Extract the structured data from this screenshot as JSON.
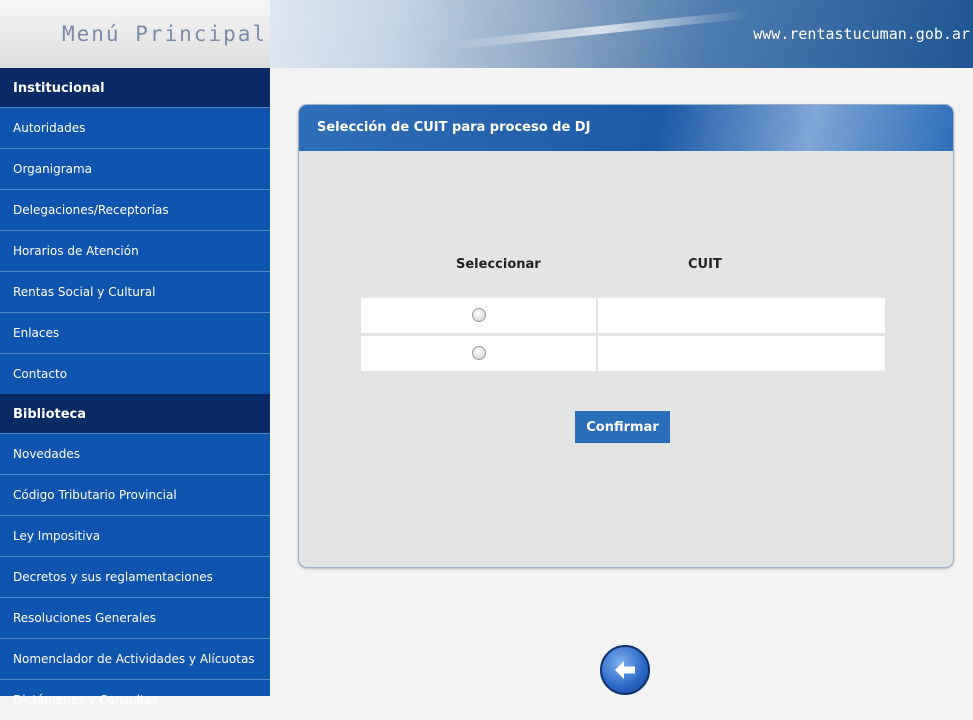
{
  "header": {
    "menu_title": "Menú Principal",
    "site_url": "www.rentastucuman.gob.ar"
  },
  "sidebar": {
    "sections": [
      {
        "title": "Institucional",
        "items": [
          "Autoridades",
          "Organigrama",
          "Delegaciones/Receptorías",
          "Horarios de Atención",
          "Rentas Social y Cultural",
          "Enlaces",
          "Contacto"
        ]
      },
      {
        "title": "Biblioteca",
        "items": [
          "Novedades",
          "Código Tributario Provincial",
          "Ley Impositiva",
          "Decretos y sus reglamentaciones",
          "Resoluciones Generales",
          "Nomenclador de Actividades y Alícuotas",
          "Dictámenes y Consultas"
        ]
      }
    ]
  },
  "panel": {
    "title": "Selección de CUIT para proceso de DJ",
    "columns": [
      "Seleccionar",
      "CUIT"
    ],
    "rows": [
      {
        "cuit": ""
      },
      {
        "cuit": ""
      }
    ],
    "confirm_label": "Confirmar"
  },
  "icons": {
    "back": "back-arrow-icon"
  },
  "colors": {
    "sidebar": "#0f54ae",
    "section": "#0a2a66",
    "button": "#2a6db8"
  }
}
